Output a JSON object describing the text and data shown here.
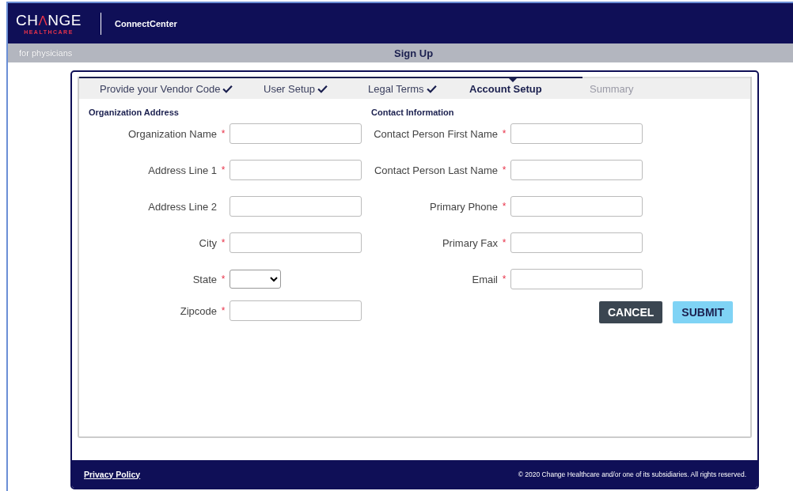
{
  "header": {
    "logo_top": "CH",
    "logo_mark": "Λ",
    "logo_rest": "NGE",
    "logo_bottom": "HEALTHCARE",
    "app_name": "ConnectCenter"
  },
  "subbar": {
    "tagline": "for physicians",
    "title": "Sign Up"
  },
  "steps": [
    {
      "label": "Provide your Vendor Code",
      "completed": true,
      "selected": false
    },
    {
      "label": "User Setup",
      "completed": true,
      "selected": false
    },
    {
      "label": "Legal Terms",
      "completed": true,
      "selected": false
    },
    {
      "label": "Account Setup",
      "completed": false,
      "selected": true
    },
    {
      "label": "Summary",
      "completed": false,
      "selected": false
    }
  ],
  "sections": [
    {
      "title": "Organization Address",
      "fields": [
        {
          "label": "Organization Name",
          "required": true,
          "kind": "text"
        },
        {
          "label": "Address Line 1",
          "required": true,
          "kind": "text"
        },
        {
          "label": "Address Line 2",
          "required": false,
          "kind": "text"
        },
        {
          "label": "City",
          "required": true,
          "kind": "text"
        },
        {
          "label": "State",
          "required": true,
          "kind": "select"
        },
        {
          "label": "Zipcode",
          "required": true,
          "kind": "text"
        }
      ]
    },
    {
      "title": "Contact Information",
      "fields": [
        {
          "label": "Contact Person First Name",
          "required": true,
          "kind": "text"
        },
        {
          "label": "Contact Person Last Name",
          "required": true,
          "kind": "text"
        },
        {
          "label": "Primary Phone",
          "required": true,
          "kind": "text"
        },
        {
          "label": "Primary Fax",
          "required": true,
          "kind": "text"
        },
        {
          "label": "Email",
          "required": true,
          "kind": "text"
        }
      ]
    }
  ],
  "required_mark": "*",
  "buttons": [
    {
      "label": "CANCEL",
      "kind": "secondary"
    },
    {
      "label": "SUBMIT",
      "kind": "primary"
    }
  ],
  "footer": {
    "link": "Privacy Policy",
    "copyright": "© 2020 Change Healthcare and/or one of its subsidiaries. All rights reserved."
  }
}
